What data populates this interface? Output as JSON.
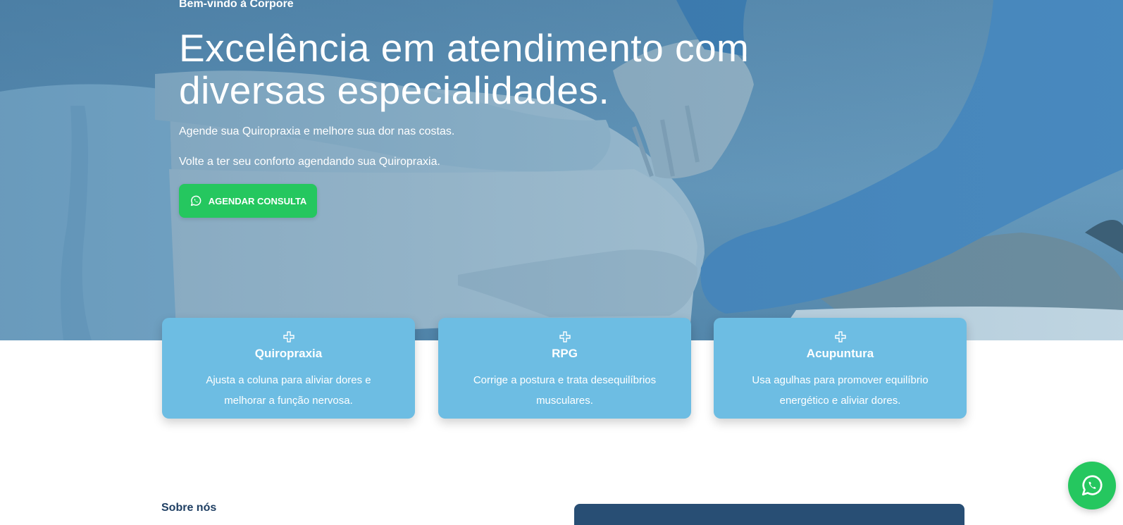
{
  "hero": {
    "eyebrow": "Bem-vindo à Corpore",
    "headline": "Excelência em atendimento com diversas especialidades.",
    "subtitle_1": "Agende sua Quiropraxia e melhore sua dor nas costas.",
    "subtitle_2": "Volte a ter seu conforto agendando sua Quiropraxia.",
    "cta_label": "AGENDAR CONSULTA",
    "cta_icon": "whatsapp-icon"
  },
  "services": [
    {
      "icon": "plus-icon",
      "title": "Quiropraxia",
      "description": "Ajusta a coluna para aliviar dores e melhorar a função nervosa."
    },
    {
      "icon": "plus-icon",
      "title": "RPG",
      "description": "Corrige a postura e trata desequilíbrios musculares."
    },
    {
      "icon": "plus-icon",
      "title": "Acupuntura",
      "description": "Usa agulhas para promover equilíbrio energético e aliviar dores."
    }
  ],
  "about": {
    "label": "Sobre nós"
  },
  "floating": {
    "icon": "whatsapp-icon"
  },
  "colors": {
    "whatsapp_green": "#25c75f",
    "card_blue": "#6dbde3",
    "navy": "#284e74",
    "hero_overlay": "#5d8fb2"
  }
}
